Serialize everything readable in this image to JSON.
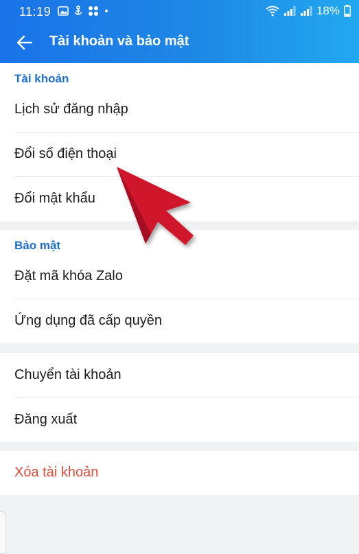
{
  "status_bar": {
    "time": "11:19",
    "battery": "18%",
    "icons": [
      "image-icon",
      "anchor-icon",
      "apps-icon",
      "dot-icon",
      "wifi-icon",
      "signal-icon",
      "signal-icon",
      "battery-icon"
    ]
  },
  "header": {
    "title": "Tài khoản và bảo mật",
    "back_icon": "arrow-left-icon"
  },
  "sections": {
    "account": {
      "heading": "Tài khoản",
      "items": [
        {
          "label": "Lịch sử đăng nhập"
        },
        {
          "label": "Đổi số điện thoại"
        },
        {
          "label": "Đổi mật khẩu"
        }
      ]
    },
    "security": {
      "heading": "Bảo mật",
      "items": [
        {
          "label": "Đặt mã khóa Zalo"
        },
        {
          "label": "Ứng dụng đã cấp quyền"
        }
      ]
    },
    "session": {
      "items": [
        {
          "label": "Chuyển tài khoản"
        },
        {
          "label": "Đăng xuất"
        }
      ]
    },
    "danger": {
      "items": [
        {
          "label": "Xóa tài khoản",
          "color": "#e24a3b"
        }
      ]
    }
  },
  "colors": {
    "header_start": "#1a73e8",
    "header_end": "#22a8f0",
    "section_heading": "#1a6fd0",
    "annotation_arrow": "#d0142c"
  }
}
